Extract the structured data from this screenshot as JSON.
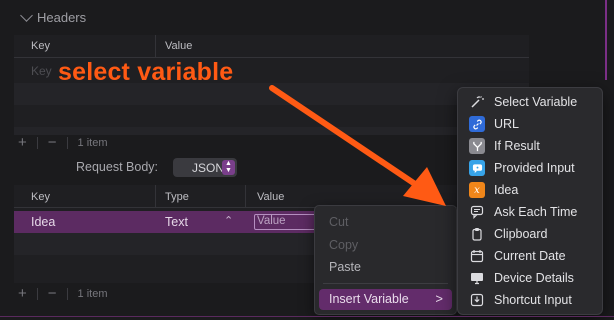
{
  "headers_section": {
    "title": "Headers",
    "columns": [
      "Key",
      "Value"
    ],
    "key_placeholder": "Key",
    "footer_count": "1 item"
  },
  "request_body": {
    "label": "Request Body:",
    "value": "JSON"
  },
  "body_table": {
    "columns": [
      "Key",
      "Type",
      "Value"
    ],
    "row": {
      "key": "Idea",
      "type": "Text",
      "value": "Value"
    },
    "footer_count": "1 item"
  },
  "context_menu": {
    "items": [
      "Cut",
      "Copy",
      "Paste"
    ],
    "insert_variable": "Insert Variable",
    "submenu_arrow": ">"
  },
  "variable_menu": {
    "items": [
      {
        "label": "Select Variable",
        "icon": "magic-wand-icon",
        "color": "#2a2a2d"
      },
      {
        "label": "URL",
        "icon": "link-icon",
        "color": "#2f6bd8"
      },
      {
        "label": "If Result",
        "icon": "branch-icon",
        "color": "#8a8a90"
      },
      {
        "label": "Provided Input",
        "icon": "chat-bubble-icon",
        "color": "#37a3e8"
      },
      {
        "label": "Idea",
        "icon": "variable-x-icon",
        "color": "#f0861a"
      },
      {
        "label": "Ask Each Time",
        "icon": "speech-bubble-icon",
        "color": "#2a2a2d"
      },
      {
        "label": "Clipboard",
        "icon": "clipboard-icon",
        "color": "#2a2a2d"
      },
      {
        "label": "Current Date",
        "icon": "calendar-icon",
        "color": "#2a2a2d"
      },
      {
        "label": "Device Details",
        "icon": "monitor-icon",
        "color": "#2a2a2d"
      },
      {
        "label": "Shortcut Input",
        "icon": "input-tray-icon",
        "color": "#2a2a2d"
      }
    ]
  },
  "annotation": {
    "text": "select variable",
    "color": "#ff5a14"
  }
}
